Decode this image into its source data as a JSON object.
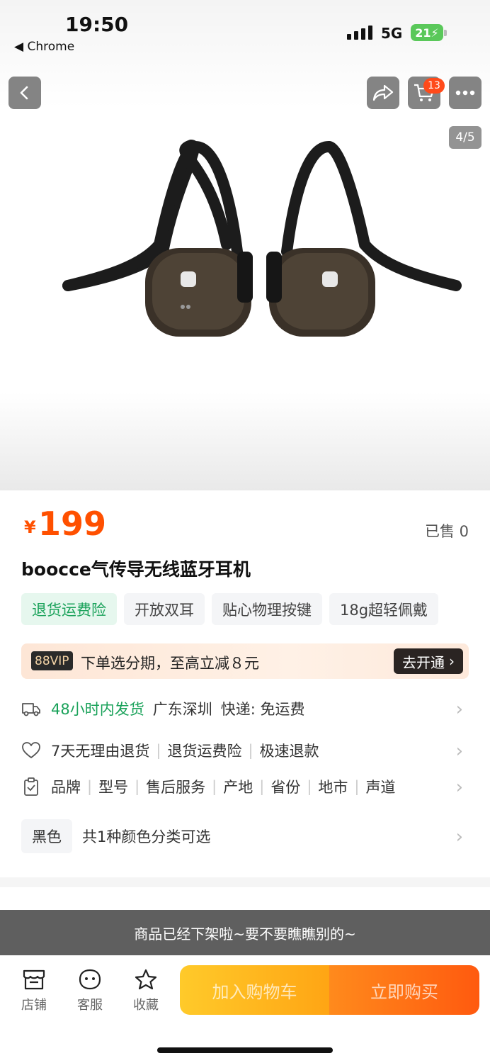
{
  "status_bar": {
    "time": "19:50",
    "back_app": "◀ Chrome",
    "network": "5G",
    "battery": "21"
  },
  "product": {
    "image_counter": "4/5",
    "cart_count": "13",
    "currency": "¥",
    "price": "199",
    "sold": "已售 0",
    "title": "boocce气传导无线蓝牙耳机",
    "tags": [
      "退货运费险",
      "开放双耳",
      "贴心物理按键",
      "18g超轻佩戴"
    ]
  },
  "vip": {
    "logo": "88VIP",
    "text": "下单选分期，至高立减８元",
    "button": "去开通"
  },
  "shipping": {
    "highlight": "48小时内发货",
    "location": "广东深圳",
    "express": "快递: 免运费"
  },
  "service": {
    "items": [
      "7天无理由退货",
      "退货运费险",
      "极速退款"
    ]
  },
  "params": {
    "items": [
      "品牌",
      "型号",
      "售后服务",
      "产地",
      "省份",
      "地市",
      "声道"
    ]
  },
  "color": {
    "tag": "黑色",
    "desc": "共1种颜色分类可选"
  },
  "notice": "商品已经下架啦~要不要瞧瞧别的~",
  "bottom_bar": {
    "shop": "店铺",
    "service": "客服",
    "favorite": "收藏",
    "add_cart": "加入购物车",
    "buy_now": "立即购买"
  },
  "colors": {
    "accent": "#ff5000",
    "green": "#1aa25a"
  }
}
